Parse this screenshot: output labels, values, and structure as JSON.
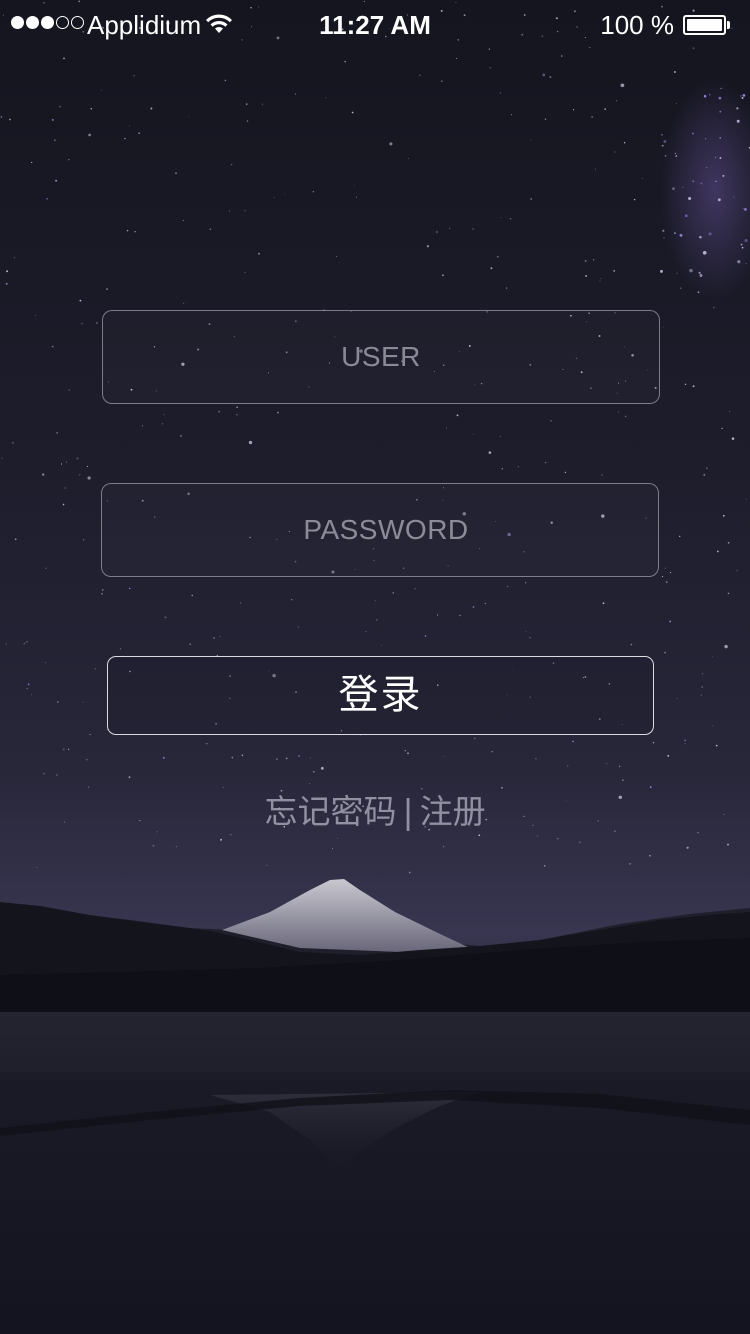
{
  "status_bar": {
    "signal_bars_filled": 3,
    "signal_bars_total": 5,
    "carrier": "Applidium",
    "time": "11:27 AM",
    "battery_text": "100 %",
    "battery_level": 1.0,
    "wifi_icon": "wifi-icon",
    "battery_icon": "battery-icon"
  },
  "login_form": {
    "user_placeholder": "USER",
    "password_placeholder": "PASSWORD",
    "login_label": "登录"
  },
  "links": {
    "forgot_password": "忘记密码",
    "separator": "|",
    "register": "注册"
  },
  "colors": {
    "sky_top": "#171826",
    "sky_mid": "#262538",
    "horizon": "#3a3850",
    "mountain_snow": "#c4c3cd",
    "treeline": "#101018",
    "lake": "#1c1c2a"
  }
}
